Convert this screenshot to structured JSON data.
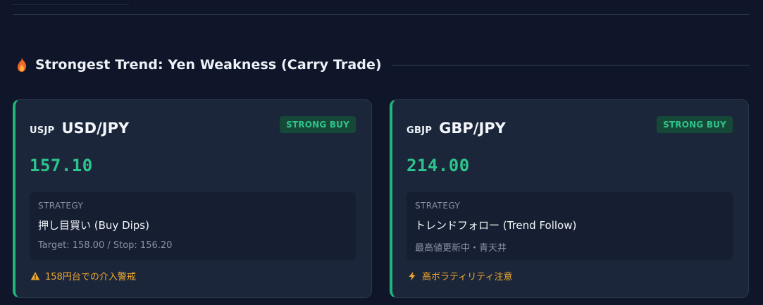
{
  "section": {
    "title": "Strongest Trend: Yen Weakness (Carry Trade)"
  },
  "cards": [
    {
      "code": "USJP",
      "pair": "USD/JPY",
      "signal": "STRONG BUY",
      "price": "157.10",
      "strategy_label": "STRATEGY",
      "strategy_name": "押し目買い (Buy Dips)",
      "strategy_detail": "Target: 158.00 / Stop: 156.20",
      "alert_icon": "warning-icon",
      "alert_text": "158円台での介入警戒"
    },
    {
      "code": "GBJP",
      "pair": "GBP/JPY",
      "signal": "STRONG BUY",
      "price": "214.00",
      "strategy_label": "STRATEGY",
      "strategy_name": "トレンドフォロー (Trend Follow)",
      "strategy_detail": "最高値更新中・青天井",
      "alert_icon": "lightning-icon",
      "alert_text": "高ボラティリティ注意"
    }
  ],
  "colors": {
    "background": "#0f1629",
    "card": "#1c263a",
    "accent_green": "#22b57a",
    "price_green": "#2cc48c",
    "warning_orange": "#f0a82e"
  }
}
